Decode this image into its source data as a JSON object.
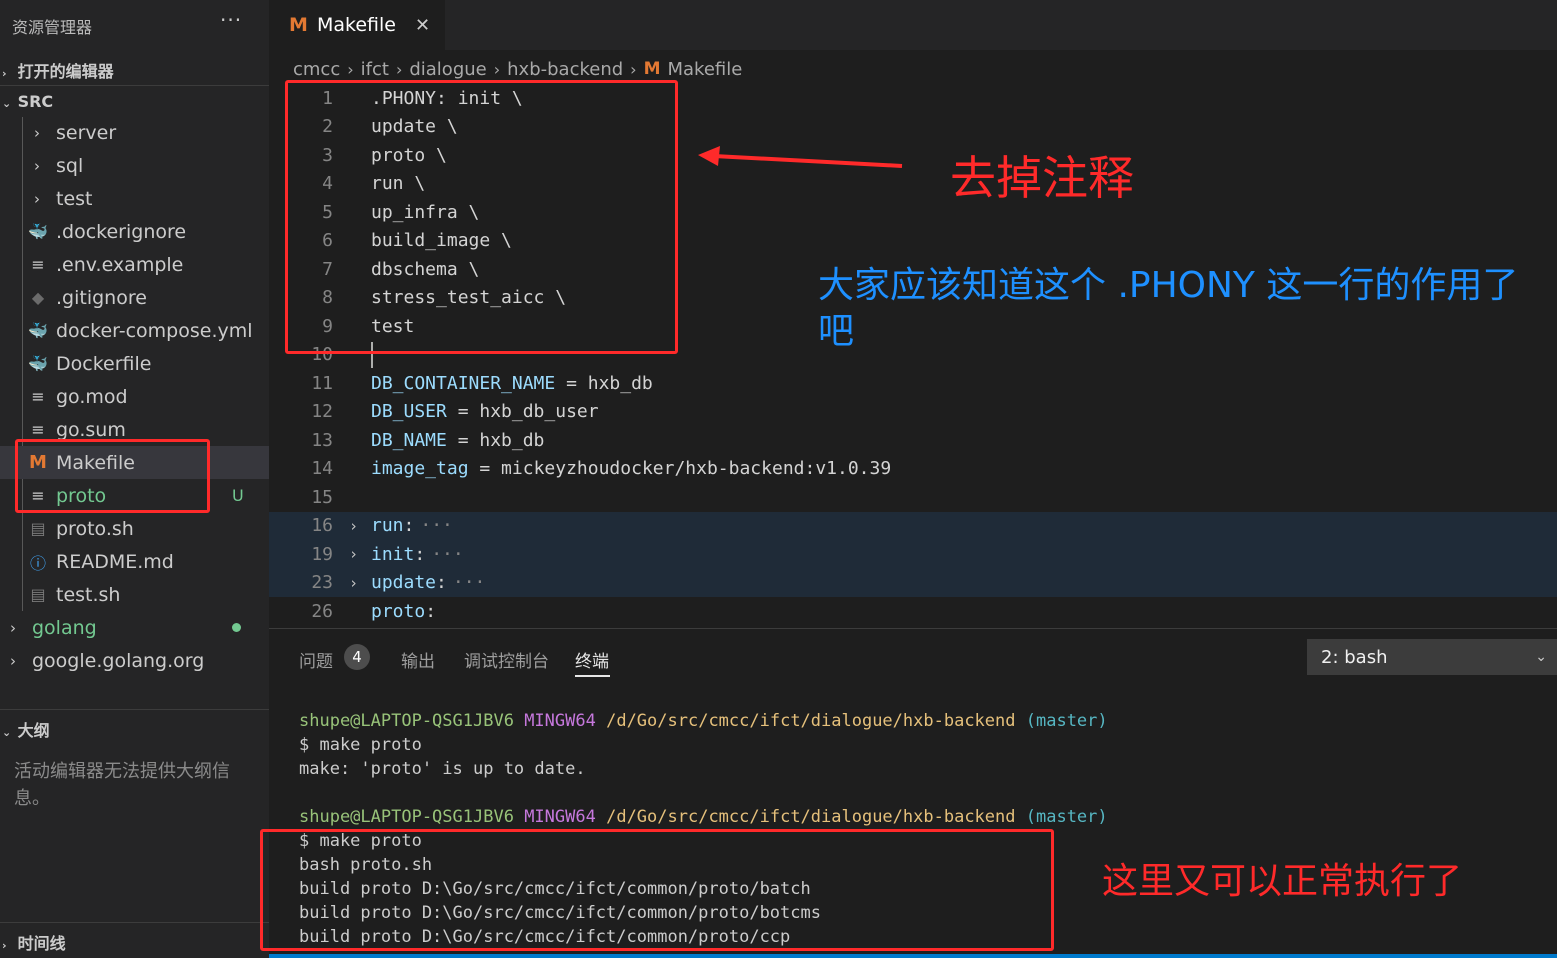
{
  "sidebar": {
    "title": "资源管理器",
    "more": "···",
    "open_editors": "打开的编辑器",
    "root": "SRC",
    "items": [
      {
        "label": "server",
        "type": "folder"
      },
      {
        "label": "sql",
        "type": "folder"
      },
      {
        "label": "test",
        "type": "folder"
      },
      {
        "label": ".dockerignore",
        "icon": "docker-icon"
      },
      {
        "label": ".env.example",
        "icon": "file-lines-icon"
      },
      {
        "label": ".gitignore",
        "icon": "git-icon"
      },
      {
        "label": "docker-compose.yml",
        "icon": "docker-compose-icon"
      },
      {
        "label": "Dockerfile",
        "icon": "docker-icon"
      },
      {
        "label": "go.mod",
        "icon": "file-lines-icon"
      },
      {
        "label": "go.sum",
        "icon": "file-lines-icon"
      },
      {
        "label": "Makefile",
        "icon": "makefile-icon"
      },
      {
        "label": "proto",
        "icon": "file-lines-icon",
        "badge": "U"
      },
      {
        "label": "proto.sh",
        "icon": "shell-icon"
      },
      {
        "label": "README.md",
        "icon": "info-icon"
      },
      {
        "label": "test.sh",
        "icon": "shell-icon"
      }
    ],
    "top_folders": [
      {
        "label": "golang"
      },
      {
        "label": "google.golang.org"
      }
    ],
    "outline_title": "大纲",
    "outline_message": "活动编辑器无法提供大纲信息。",
    "timeline_title": "时间线"
  },
  "editor": {
    "tab": {
      "icon": "M",
      "label": "Makefile",
      "close": "✕"
    },
    "breadcrumb": [
      "cmcc",
      "ifct",
      "dialogue",
      "hxb-backend",
      "Makefile"
    ],
    "lines": [
      {
        "n": "1",
        "text": ".PHONY: init \\"
      },
      {
        "n": "2",
        "text": "update \\"
      },
      {
        "n": "3",
        "text": "proto \\"
      },
      {
        "n": "4",
        "text": "run \\"
      },
      {
        "n": "5",
        "text": "up_infra \\"
      },
      {
        "n": "6",
        "text": "build_image \\"
      },
      {
        "n": "7",
        "text": "dbschema \\"
      },
      {
        "n": "8",
        "text": "stress_test_aicc \\"
      },
      {
        "n": "9",
        "text": "test"
      },
      {
        "n": "10",
        "text": ""
      },
      {
        "n": "11",
        "var": "DB_CONTAINER_NAME",
        "rest": " = hxb_db"
      },
      {
        "n": "12",
        "var": "DB_USER",
        "rest": " = hxb_db_user"
      },
      {
        "n": "13",
        "var": "DB_NAME",
        "rest": " = hxb_db"
      },
      {
        "n": "14",
        "var": "image_tag",
        "rest": " = mickeyzhoudocker/hxb-backend:v1.0.39"
      },
      {
        "n": "15",
        "text": ""
      },
      {
        "n": "16",
        "var": "run",
        "rest": ":",
        "folded": true,
        "ellipsis": "···"
      },
      {
        "n": "19",
        "var": "init",
        "rest": ":",
        "folded": true,
        "ellipsis": "···"
      },
      {
        "n": "23",
        "var": "update",
        "rest": ":",
        "folded": true,
        "ellipsis": "···"
      },
      {
        "n": "26",
        "var": "proto",
        "rest": ":"
      }
    ]
  },
  "panel": {
    "tabs": [
      "问题",
      "输出",
      "调试控制台",
      "终端"
    ],
    "problems_count": "4",
    "terminal_select": "2: bash",
    "terminal": [
      {
        "kind": "prompt",
        "user": "shupe@LAPTOP-QSG1JBV6",
        "host": "MINGW64",
        "path": "/d/Go/src/cmcc/ifct/dialogue/hxb-backend",
        "branch": "(master)"
      },
      {
        "kind": "text",
        "text": "$ make proto"
      },
      {
        "kind": "text",
        "text": "make: 'proto' is up to date."
      },
      {
        "kind": "blank",
        "text": ""
      },
      {
        "kind": "prompt",
        "user": "shupe@LAPTOP-QSG1JBV6",
        "host": "MINGW64",
        "path": "/d/Go/src/cmcc/ifct/dialogue/hxb-backend",
        "branch": "(master)"
      },
      {
        "kind": "text",
        "text": "$ make proto"
      },
      {
        "kind": "text",
        "text": "bash proto.sh"
      },
      {
        "kind": "text",
        "text": "build proto D:\\Go/src/cmcc/ifct/common/proto/batch"
      },
      {
        "kind": "text",
        "text": "build proto D:\\Go/src/cmcc/ifct/common/proto/botcms"
      },
      {
        "kind": "text",
        "text": "build proto D:\\Go/src/cmcc/ifct/common/proto/ccp"
      }
    ]
  },
  "annotations": {
    "remove_comments": "去掉注释",
    "phony_note": "大家应该知道这个 .PHONY 这一行的作用了吧",
    "works_again": "这里又可以正常执行了"
  },
  "colors": {
    "annotation_red": "#ff2a2a",
    "annotation_blue": "#1e90ff",
    "makefile_icon": "#e37933",
    "untracked_green": "#73c991"
  }
}
